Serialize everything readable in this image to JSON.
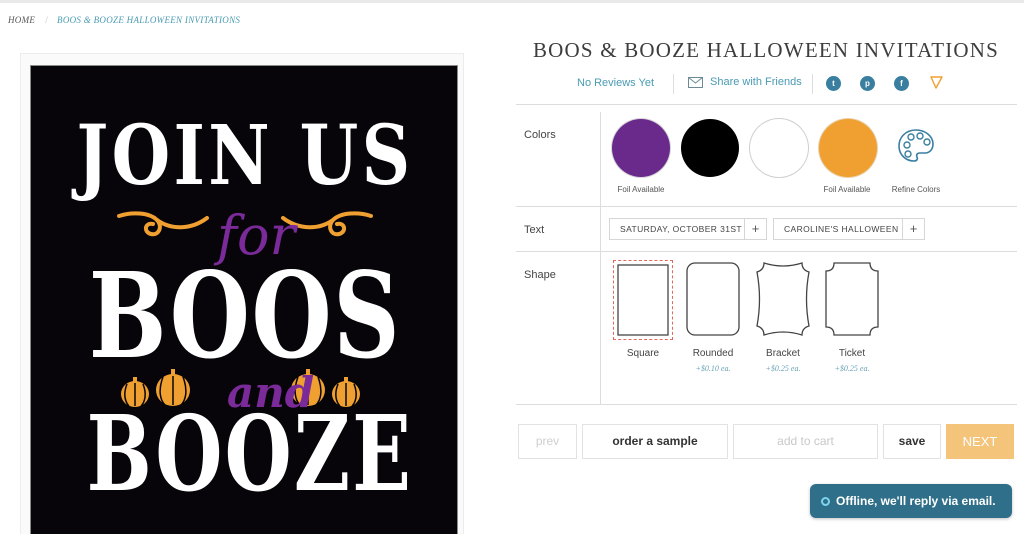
{
  "breadcrumb": {
    "home": "HOME",
    "separator": "/",
    "current": "BOOS & BOOZE HALLOWEEN INVITATIONS"
  },
  "preview": {
    "line1": "JOIN US",
    "line2": "for",
    "line3": "BOOS",
    "line4": "and",
    "line5": "BOOZE"
  },
  "product": {
    "title": "BOOS & BOOZE HALLOWEEN INVITATIONS",
    "reviews": "No Reviews Yet",
    "share": "Share with Friends",
    "social": [
      {
        "name": "twitter",
        "glyph": "t"
      },
      {
        "name": "pinterest",
        "glyph": "p"
      },
      {
        "name": "facebook",
        "glyph": "f"
      }
    ]
  },
  "colors": {
    "label": "Colors",
    "swatches": [
      {
        "color": "#6a2a8c",
        "label": "Foil Available"
      },
      {
        "color": "#000000",
        "label": ""
      },
      {
        "color": "#ffffff",
        "label": ""
      },
      {
        "color": "#f0a030",
        "label": "Foil Available"
      }
    ],
    "refine": "Refine Colors"
  },
  "text": {
    "label": "Text",
    "fields": [
      "SATURDAY, OCTOBER 31ST",
      "CAROLINE'S HALLOWEEN"
    ],
    "add": "+"
  },
  "shape": {
    "label": "Shape",
    "options": [
      {
        "name": "Square",
        "price": ""
      },
      {
        "name": "Rounded",
        "price": "+$0.10 ea."
      },
      {
        "name": "Bracket",
        "price": "+$0.25 ea."
      },
      {
        "name": "Ticket",
        "price": "+$0.25 ea."
      }
    ]
  },
  "actions": {
    "prev": "prev",
    "sample": "order a sample",
    "cart": "add to cart",
    "save": "save",
    "next": "NEXT"
  },
  "chat": {
    "status": "Offline, we'll reply via email."
  },
  "palette": {
    "accent": "#4a9bb3",
    "orange": "#f0a030",
    "purple": "#7a2a99",
    "next_bg": "#f3c47a",
    "chat_bg": "#2f6f89"
  }
}
